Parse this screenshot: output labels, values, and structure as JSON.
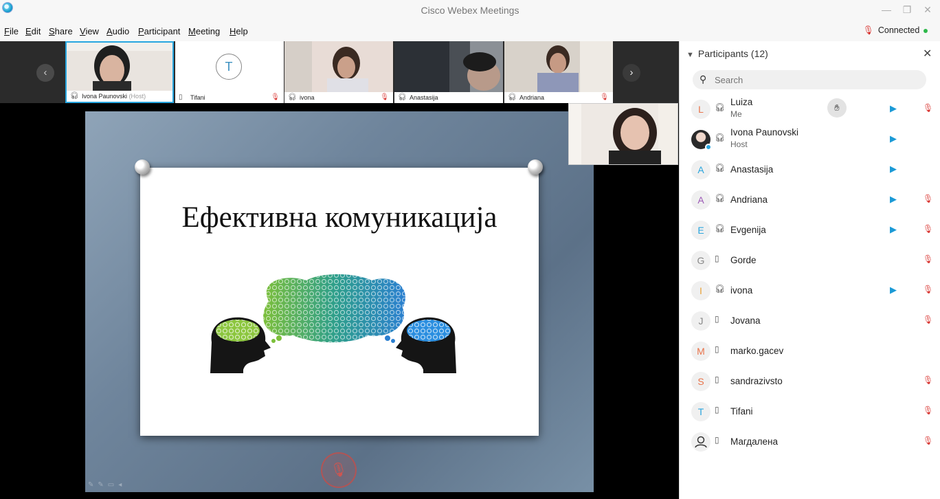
{
  "window": {
    "title": "Cisco Webex Meetings",
    "min": "—",
    "max": "❐",
    "close": "✕"
  },
  "menu": [
    {
      "u": "F",
      "rest": "ile"
    },
    {
      "u": "E",
      "rest": "dit"
    },
    {
      "u": "S",
      "rest": "hare"
    },
    {
      "u": "V",
      "rest": "iew"
    },
    {
      "u": "A",
      "rest": "udio"
    },
    {
      "u": "P",
      "rest": "articipant"
    },
    {
      "u": "M",
      "rest": "eeting"
    },
    {
      "u": "H",
      "rest": "elp"
    }
  ],
  "connection": {
    "label": "Connected",
    "mic_icon": "mic-muted-icon",
    "color": "#2db84a"
  },
  "strip": {
    "prev": "‹",
    "next": "›",
    "thumbs": [
      {
        "name": "Ivona Paunovski",
        "suffix": "(Host)",
        "device": "headset",
        "muted": false
      },
      {
        "name": "Tifani",
        "initial": "T",
        "device": "phone",
        "muted": true
      },
      {
        "name": "ivona",
        "device": "headset",
        "muted": true
      },
      {
        "name": "Anastasija",
        "device": "headset",
        "muted": false
      },
      {
        "name": "Andriana",
        "device": "headset",
        "muted": true
      }
    ]
  },
  "slide": {
    "title": "Ефективна комуникација"
  },
  "panel": {
    "title": "Participants (12)",
    "close": "✕",
    "search_placeholder": "Search",
    "participants": [
      {
        "initial": "L",
        "color": "#e8734a",
        "name": "Luiza",
        "role": "Me",
        "device": "headset",
        "video": true,
        "muted": true,
        "hand": true
      },
      {
        "initial": "",
        "photo": true,
        "name": "Ivona Paunovski",
        "role": "Host",
        "device": "headset",
        "video": true,
        "muted": false
      },
      {
        "initial": "A",
        "color": "#2aa5dd",
        "name": "Anastasija",
        "device": "headset",
        "video": true,
        "muted": false
      },
      {
        "initial": "A",
        "color": "#9b59b6",
        "name": "Andriana",
        "device": "headset",
        "video": true,
        "muted": true
      },
      {
        "initial": "E",
        "color": "#2aa5dd",
        "name": "Evgenija",
        "device": "headset",
        "video": true,
        "muted": true
      },
      {
        "initial": "G",
        "color": "#888888",
        "name": "Gorde",
        "device": "phone",
        "video": false,
        "muted": true
      },
      {
        "initial": "I",
        "color": "#e8a33a",
        "name": "ivona",
        "device": "headset",
        "video": true,
        "muted": true
      },
      {
        "initial": "J",
        "color": "#888888",
        "name": "Jovana",
        "device": "phone",
        "video": false,
        "muted": true
      },
      {
        "initial": "M",
        "color": "#e8734a",
        "name": "marko.gacev",
        "device": "phone",
        "video": false,
        "muted": false
      },
      {
        "initial": "S",
        "color": "#e8734a",
        "name": "sandrazivsto",
        "device": "phone",
        "video": false,
        "muted": true
      },
      {
        "initial": "T",
        "color": "#2aa5dd",
        "name": "Tifani",
        "device": "phone",
        "video": false,
        "muted": true
      },
      {
        "initial": "",
        "person": true,
        "name": "Магдалена",
        "device": "phone",
        "video": false,
        "muted": true
      }
    ]
  }
}
